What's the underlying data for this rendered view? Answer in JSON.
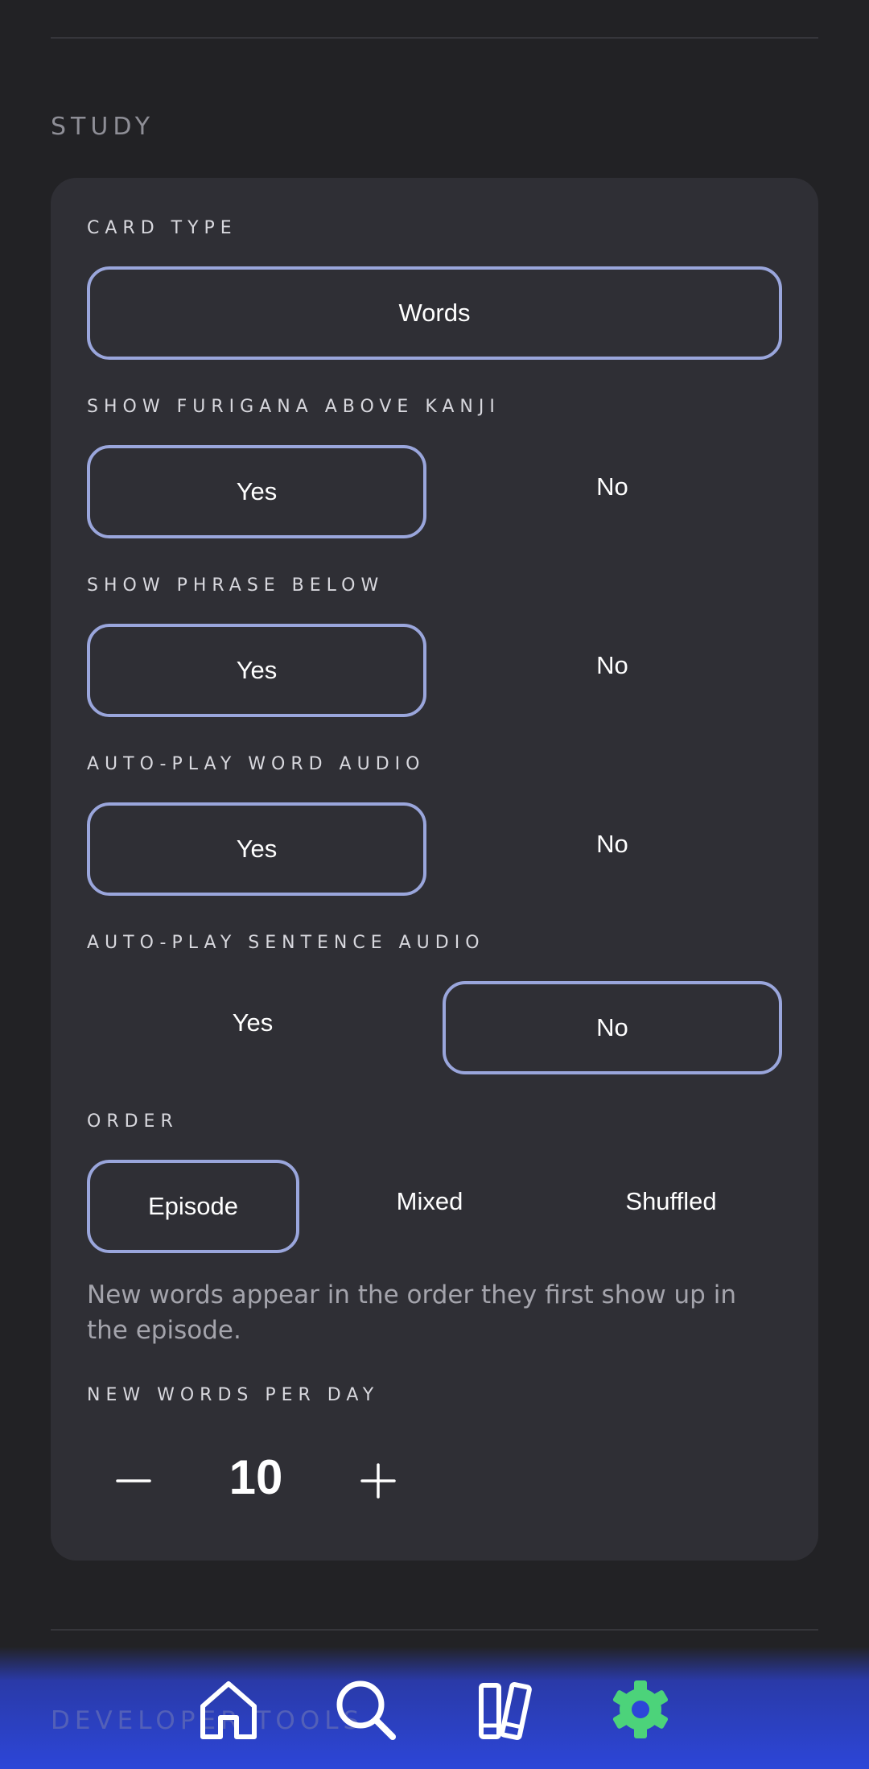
{
  "section": {
    "title": "STUDY"
  },
  "card_type": {
    "label": "CARD TYPE",
    "value": "Words"
  },
  "furigana": {
    "label": "SHOW FURIGANA ABOVE KANJI",
    "options": [
      "Yes",
      "No"
    ],
    "selected": "Yes"
  },
  "phrase": {
    "label": "SHOW PHRASE BELOW",
    "options": [
      "Yes",
      "No"
    ],
    "selected": "Yes"
  },
  "word_audio": {
    "label": "AUTO-PLAY WORD AUDIO",
    "options": [
      "Yes",
      "No"
    ],
    "selected": "Yes"
  },
  "sentence_audio": {
    "label": "AUTO-PLAY SENTENCE AUDIO",
    "options": [
      "Yes",
      "No"
    ],
    "selected": "No"
  },
  "order": {
    "label": "ORDER",
    "options": [
      "Episode",
      "Mixed",
      "Shuffled"
    ],
    "selected": "Episode",
    "description": "New words appear in the order they first show up in the episode."
  },
  "new_words": {
    "label": "NEW WORDS PER DAY",
    "value": "10"
  },
  "next_section": {
    "title": "DEVELOPER TOOLS"
  },
  "nav": {
    "items": [
      {
        "icon": "home-icon"
      },
      {
        "icon": "search-icon"
      },
      {
        "icon": "library-icon"
      },
      {
        "icon": "gear-icon",
        "active": true
      }
    ],
    "active_color": "#4cd37a"
  },
  "colors": {
    "accent_border": "#9aa6dc",
    "background": "#222225",
    "card": "#2f2f35"
  }
}
